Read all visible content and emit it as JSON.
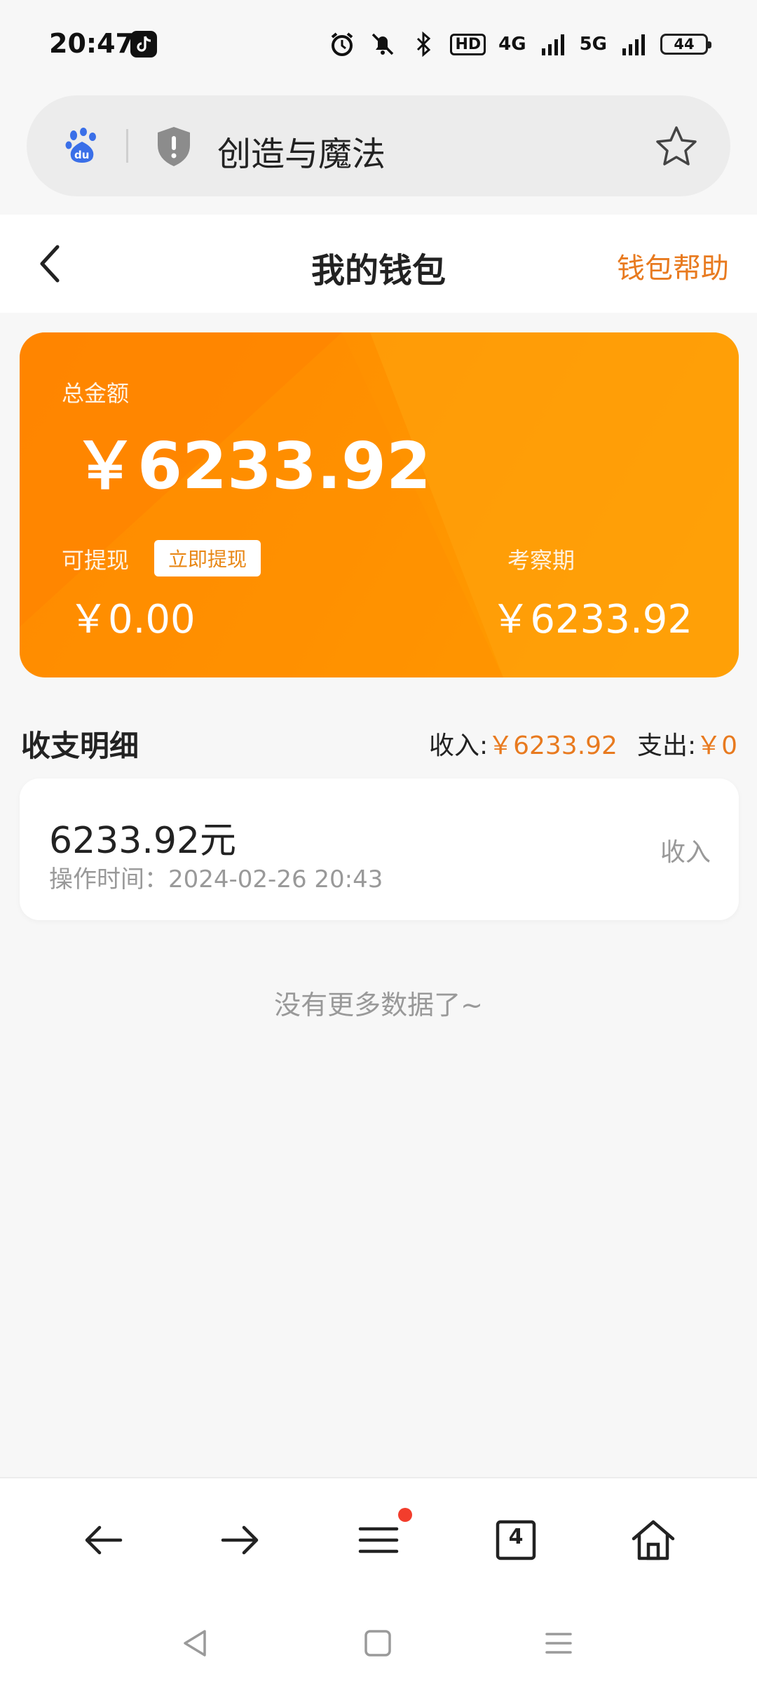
{
  "status_bar": {
    "time": "20:47",
    "network_hd": "HD",
    "signal_4g": "4G",
    "signal_5g": "5G",
    "battery": "44"
  },
  "address_bar": {
    "page_title": "创造与魔法"
  },
  "header": {
    "title": "我的钱包",
    "help_label": "钱包帮助"
  },
  "wallet": {
    "total_label": "总金额",
    "total_amount": "￥6233.92",
    "withdrawable_label": "可提现",
    "withdraw_button": "立即提现",
    "withdrawable_amount": "￥0.00",
    "review_label": "考察期",
    "review_amount": "￥6233.92"
  },
  "details": {
    "title": "收支明细",
    "income_label": "收入:",
    "income_value": "￥6233.92",
    "expense_label": "支出:",
    "expense_value": "￥0"
  },
  "transactions": [
    {
      "amount": "6233.92元",
      "time": "操作时间：2024-02-26 20:43",
      "type": "收入"
    }
  ],
  "empty_hint": "没有更多数据了~",
  "toolbar": {
    "tabs_count": "4"
  },
  "colors": {
    "accent": "#e87a1f",
    "card_orange": "#ff9200",
    "badge_red": "#f23d2c"
  }
}
